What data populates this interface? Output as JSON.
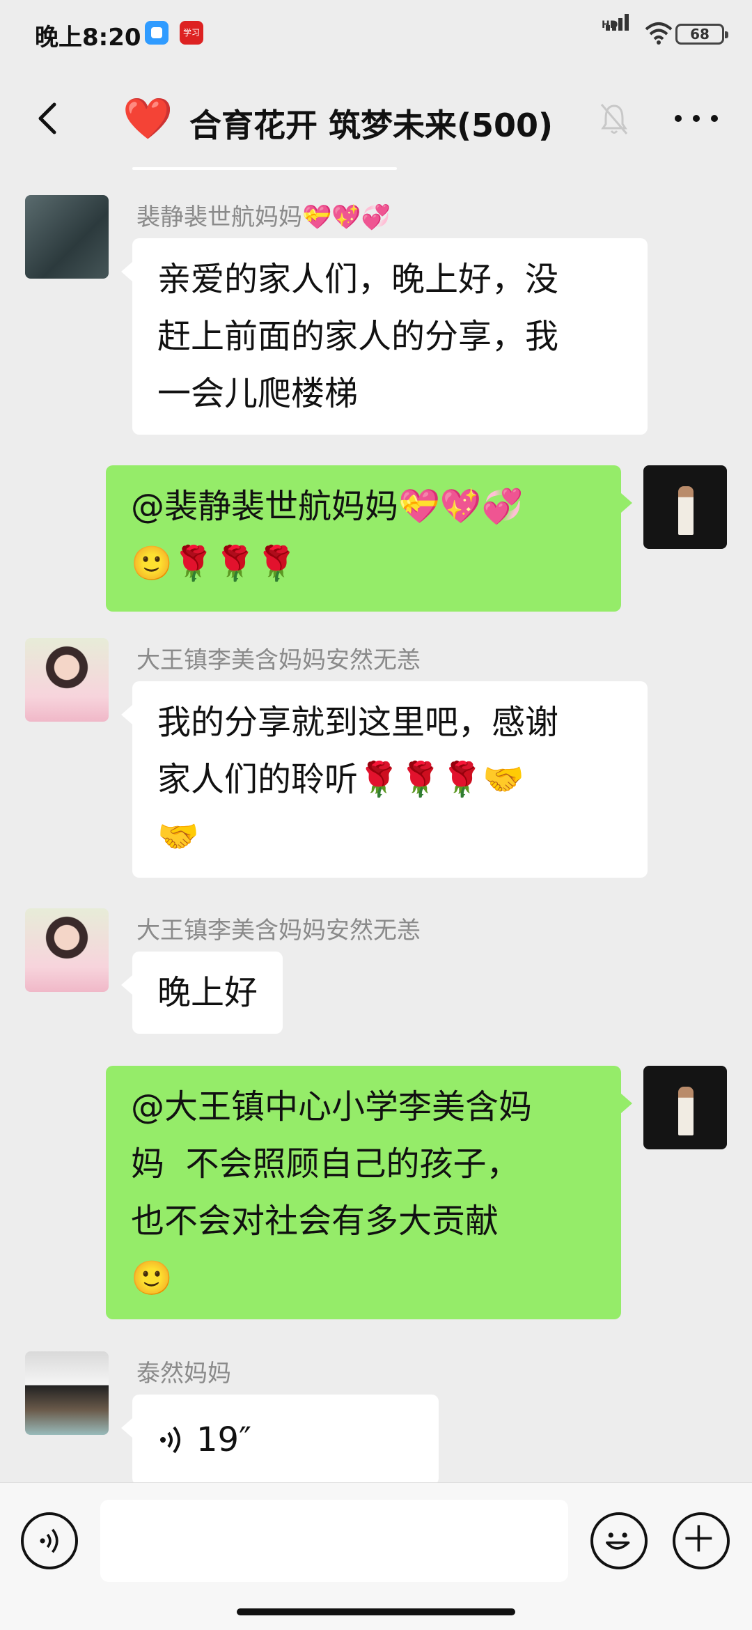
{
  "status_bar": {
    "time": "晚上8:20",
    "network_label": "HD",
    "battery": "68",
    "app_icons": [
      "blue-app-icon",
      "xuexi-app-icon"
    ],
    "xuexi_label": "学习"
  },
  "nav": {
    "title": "合育花开 筑梦未来(500)",
    "title_emoji": "❤️",
    "icons": [
      "back-icon",
      "mute-bell-icon",
      "more-icon"
    ]
  },
  "messages": [
    {
      "side": "left",
      "sender": "裴静裴世航妈妈💝💖💞",
      "text": "亲爱的家人们，晚上好，没\n赶上前面的家人的分享，我\n一会儿爬楼梯"
    },
    {
      "side": "right",
      "text": "@裴静裴世航妈妈💝💖💞\n🙂🌹🌹🌹"
    },
    {
      "side": "left",
      "sender": "大王镇李美含妈妈安然无恙",
      "text": "我的分享就到这里吧，感谢\n家人们的聆听🌹🌹🌹🤝\n🤝"
    },
    {
      "side": "left",
      "sender": "大王镇李美含妈妈安然无恙",
      "text": "晚上好"
    },
    {
      "side": "right",
      "text": "@大王镇中心小学李美含妈\n妈  不会照顾自己的孩子，\n也不会对社会有多大贡献\n🙂"
    },
    {
      "side": "left",
      "sender": "泰然妈妈",
      "voice_duration": "19″"
    }
  ],
  "input_bar": {
    "placeholder": "",
    "icons": [
      "voice-input-icon",
      "emoji-icon",
      "plus-icon"
    ]
  },
  "colors": {
    "background": "#ededed",
    "outgoing_bubble": "#95ec69",
    "incoming_bubble": "#ffffff",
    "sender_name": "#8a8a8a"
  }
}
